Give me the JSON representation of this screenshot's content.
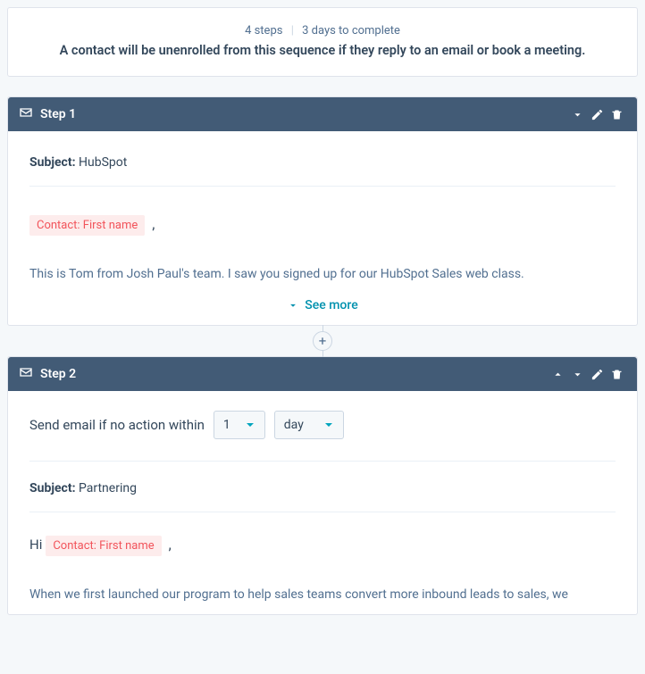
{
  "summary": {
    "steps": "4 steps",
    "duration": "3 days to complete",
    "message": "A contact will be unenrolled from this sequence if they reply to an email or book a meeting."
  },
  "step1": {
    "title": "Step 1",
    "subject_label": "Subject:",
    "subject_value": "HubSpot",
    "token": "Contact: First name",
    "comma": ",",
    "preview": "This is Tom from Josh Paul's team. I saw you signed up for our HubSpot Sales web class.",
    "see_more": "See more"
  },
  "step2": {
    "title": "Step 2",
    "wait_label": "Send email if no action within",
    "wait_value": "1",
    "wait_unit": "day",
    "subject_label": "Subject:",
    "subject_value": "Partnering",
    "greeting": "Hi",
    "token": "Contact: First name",
    "comma": ",",
    "preview": "When we first launched our program to help sales teams convert more inbound leads to sales, we"
  }
}
